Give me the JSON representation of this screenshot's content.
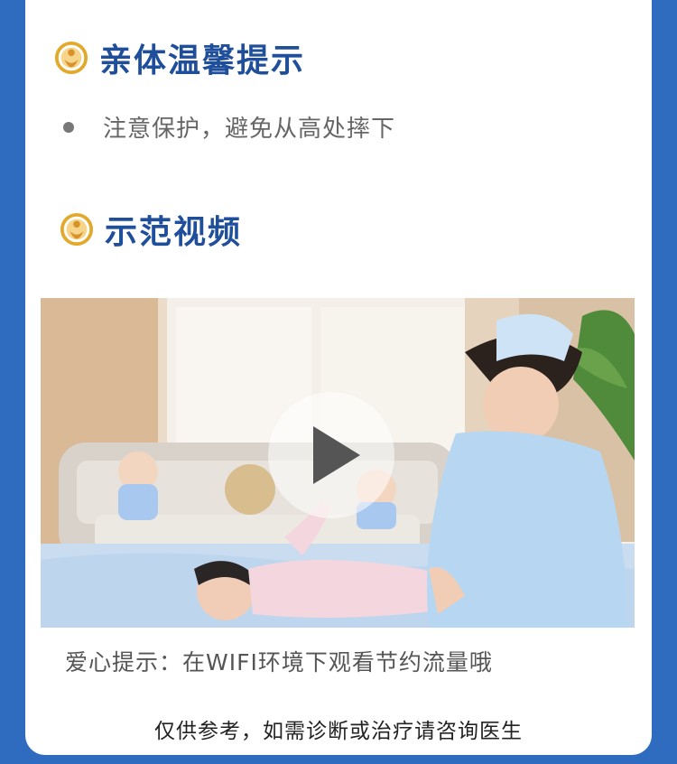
{
  "section1": {
    "title": "亲体温馨提示",
    "tips": [
      "注意保护，避免从高处摔下"
    ]
  },
  "section2": {
    "title": "示范视频"
  },
  "video": {
    "hint": "爱心提示：在WIFI环境下观看节约流量哦",
    "play_icon": "play-icon"
  },
  "footer": {
    "disclaimer": "仅供参考，如需诊断或治疗请咨询医生"
  },
  "colors": {
    "frame": "#2f6cc0",
    "title": "#1f4e9a",
    "logo_gold": "#e2a92b"
  }
}
